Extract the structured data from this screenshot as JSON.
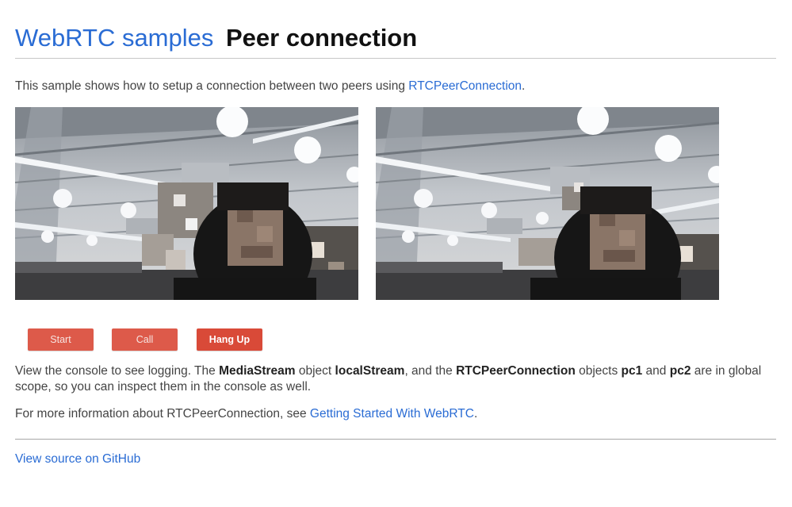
{
  "header": {
    "site_link": "WebRTC samples",
    "page_title": "Peer connection"
  },
  "intro": {
    "text_before": "This sample shows how to setup a connection between two peers using ",
    "link": "RTCPeerConnection",
    "text_after": "."
  },
  "videos": {
    "local": "local-video",
    "remote": "remote-video"
  },
  "buttons": {
    "start": "Start",
    "call": "Call",
    "hangup": "Hang Up"
  },
  "console_paragraph": {
    "t1": "View the console to see logging. The ",
    "b1": "MediaStream",
    "t2": " object ",
    "b2": "localStream",
    "t3": ", and the ",
    "b3": "RTCPeerConnection",
    "t4": " objects ",
    "b4": "pc1",
    "t5": " and ",
    "b5": "pc2",
    "t6": " are in global scope, so you can inspect them in the console as well."
  },
  "info_paragraph": {
    "text_before": "For more information about RTCPeerConnection, see ",
    "link": "Getting Started With WebRTC",
    "text_after": "."
  },
  "footer": {
    "source_link": "View source on GitHub"
  },
  "colors": {
    "link": "#2a6cd4",
    "button": "#d94a38",
    "title": "#111111"
  }
}
